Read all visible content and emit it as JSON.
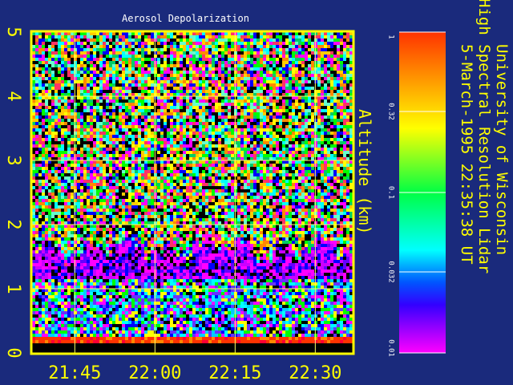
{
  "chart_data": {
    "type": "heatmap",
    "title": "Aerosol Depolarization",
    "ylabel": "Altitude (km)",
    "y_ticks": [
      "0",
      "1",
      "2",
      "3",
      "4",
      "5"
    ],
    "ylim": [
      0,
      5
    ],
    "x_ticks": [
      "21:45",
      "22:00",
      "22:15",
      "22:30"
    ],
    "xlim": [
      "21:37",
      "22:37"
    ],
    "colorbar": {
      "scale": "log",
      "range": [
        0.01,
        1
      ],
      "ticks": [
        "1",
        "0.32",
        "0.1",
        "0.032",
        "0.01"
      ],
      "colors": [
        "#ff00ff",
        "#0000ff",
        "#00ffff",
        "#00ff00",
        "#ffff00",
        "#ff8800",
        "#ff0000"
      ]
    },
    "grid": true,
    "features": {
      "aerosol_layer_top_km": 1.8,
      "aerosol_layer_base_km": 1.2,
      "ground_return_km": 0.15
    }
  },
  "instrument": {
    "line1": "University of Wisconsin",
    "line2": "High Spectral Resolution Lidar",
    "line3": "5-March-1995 22:35:38 UT"
  },
  "colors": {
    "background": "#1a2a7c",
    "axis": "#ffff00",
    "title": "#ffffff"
  }
}
